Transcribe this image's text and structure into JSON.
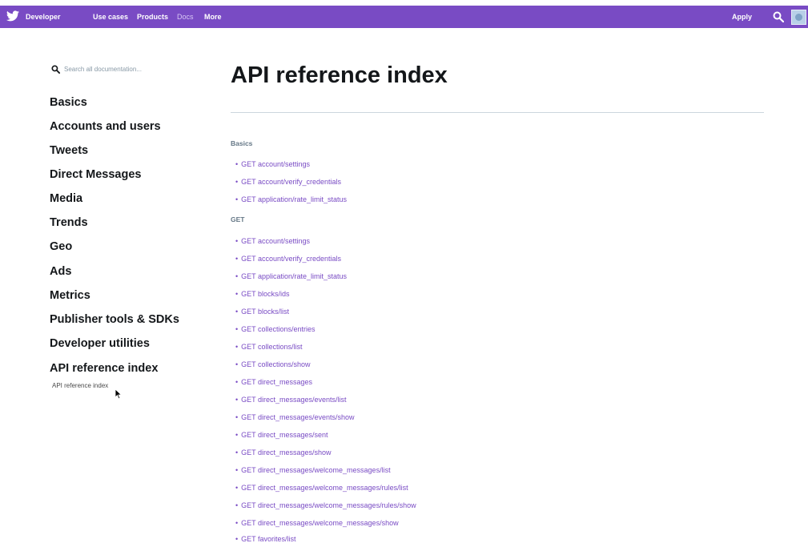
{
  "nav": {
    "brand": "Developer",
    "items": [
      "Use cases",
      "Products",
      "Docs",
      "More"
    ],
    "apply": "Apply",
    "icons": {
      "logo": "twitter-bird-icon",
      "search": "search-icon",
      "avatar": "avatar"
    },
    "colors": {
      "bar": "#794bc4",
      "text": "#ffffff"
    }
  },
  "sidebar": {
    "search_placeholder": "Search all documentation...",
    "items": [
      "Basics",
      "Accounts and users",
      "Tweets",
      "Direct Messages",
      "Media",
      "Trends",
      "Geo",
      "Ads",
      "Metrics",
      "Publisher tools & SDKs",
      "Developer utilities",
      "API reference index"
    ],
    "sub_item": "API reference index"
  },
  "main": {
    "title": "API reference index",
    "sections": [
      {
        "heading": "Basics",
        "links": [
          "GET account/settings",
          "GET account/verify_credentials",
          "GET application/rate_limit_status"
        ]
      },
      {
        "heading": "GET",
        "links": [
          "GET account/settings",
          "GET account/verify_credentials",
          "GET application/rate_limit_status",
          "GET blocks/ids",
          "GET blocks/list",
          "GET collections/entries",
          "GET collections/list",
          "GET collections/show",
          "GET direct_messages",
          "GET direct_messages/events/list",
          "GET direct_messages/events/show",
          "GET direct_messages/sent",
          "GET direct_messages/show",
          "GET direct_messages/welcome_messages/list",
          "GET direct_messages/welcome_messages/rules/list",
          "GET direct_messages/welcome_messages/rules/show",
          "GET direct_messages/welcome_messages/show",
          "GET favorites/list"
        ]
      }
    ],
    "link_color": "#794bc4"
  }
}
